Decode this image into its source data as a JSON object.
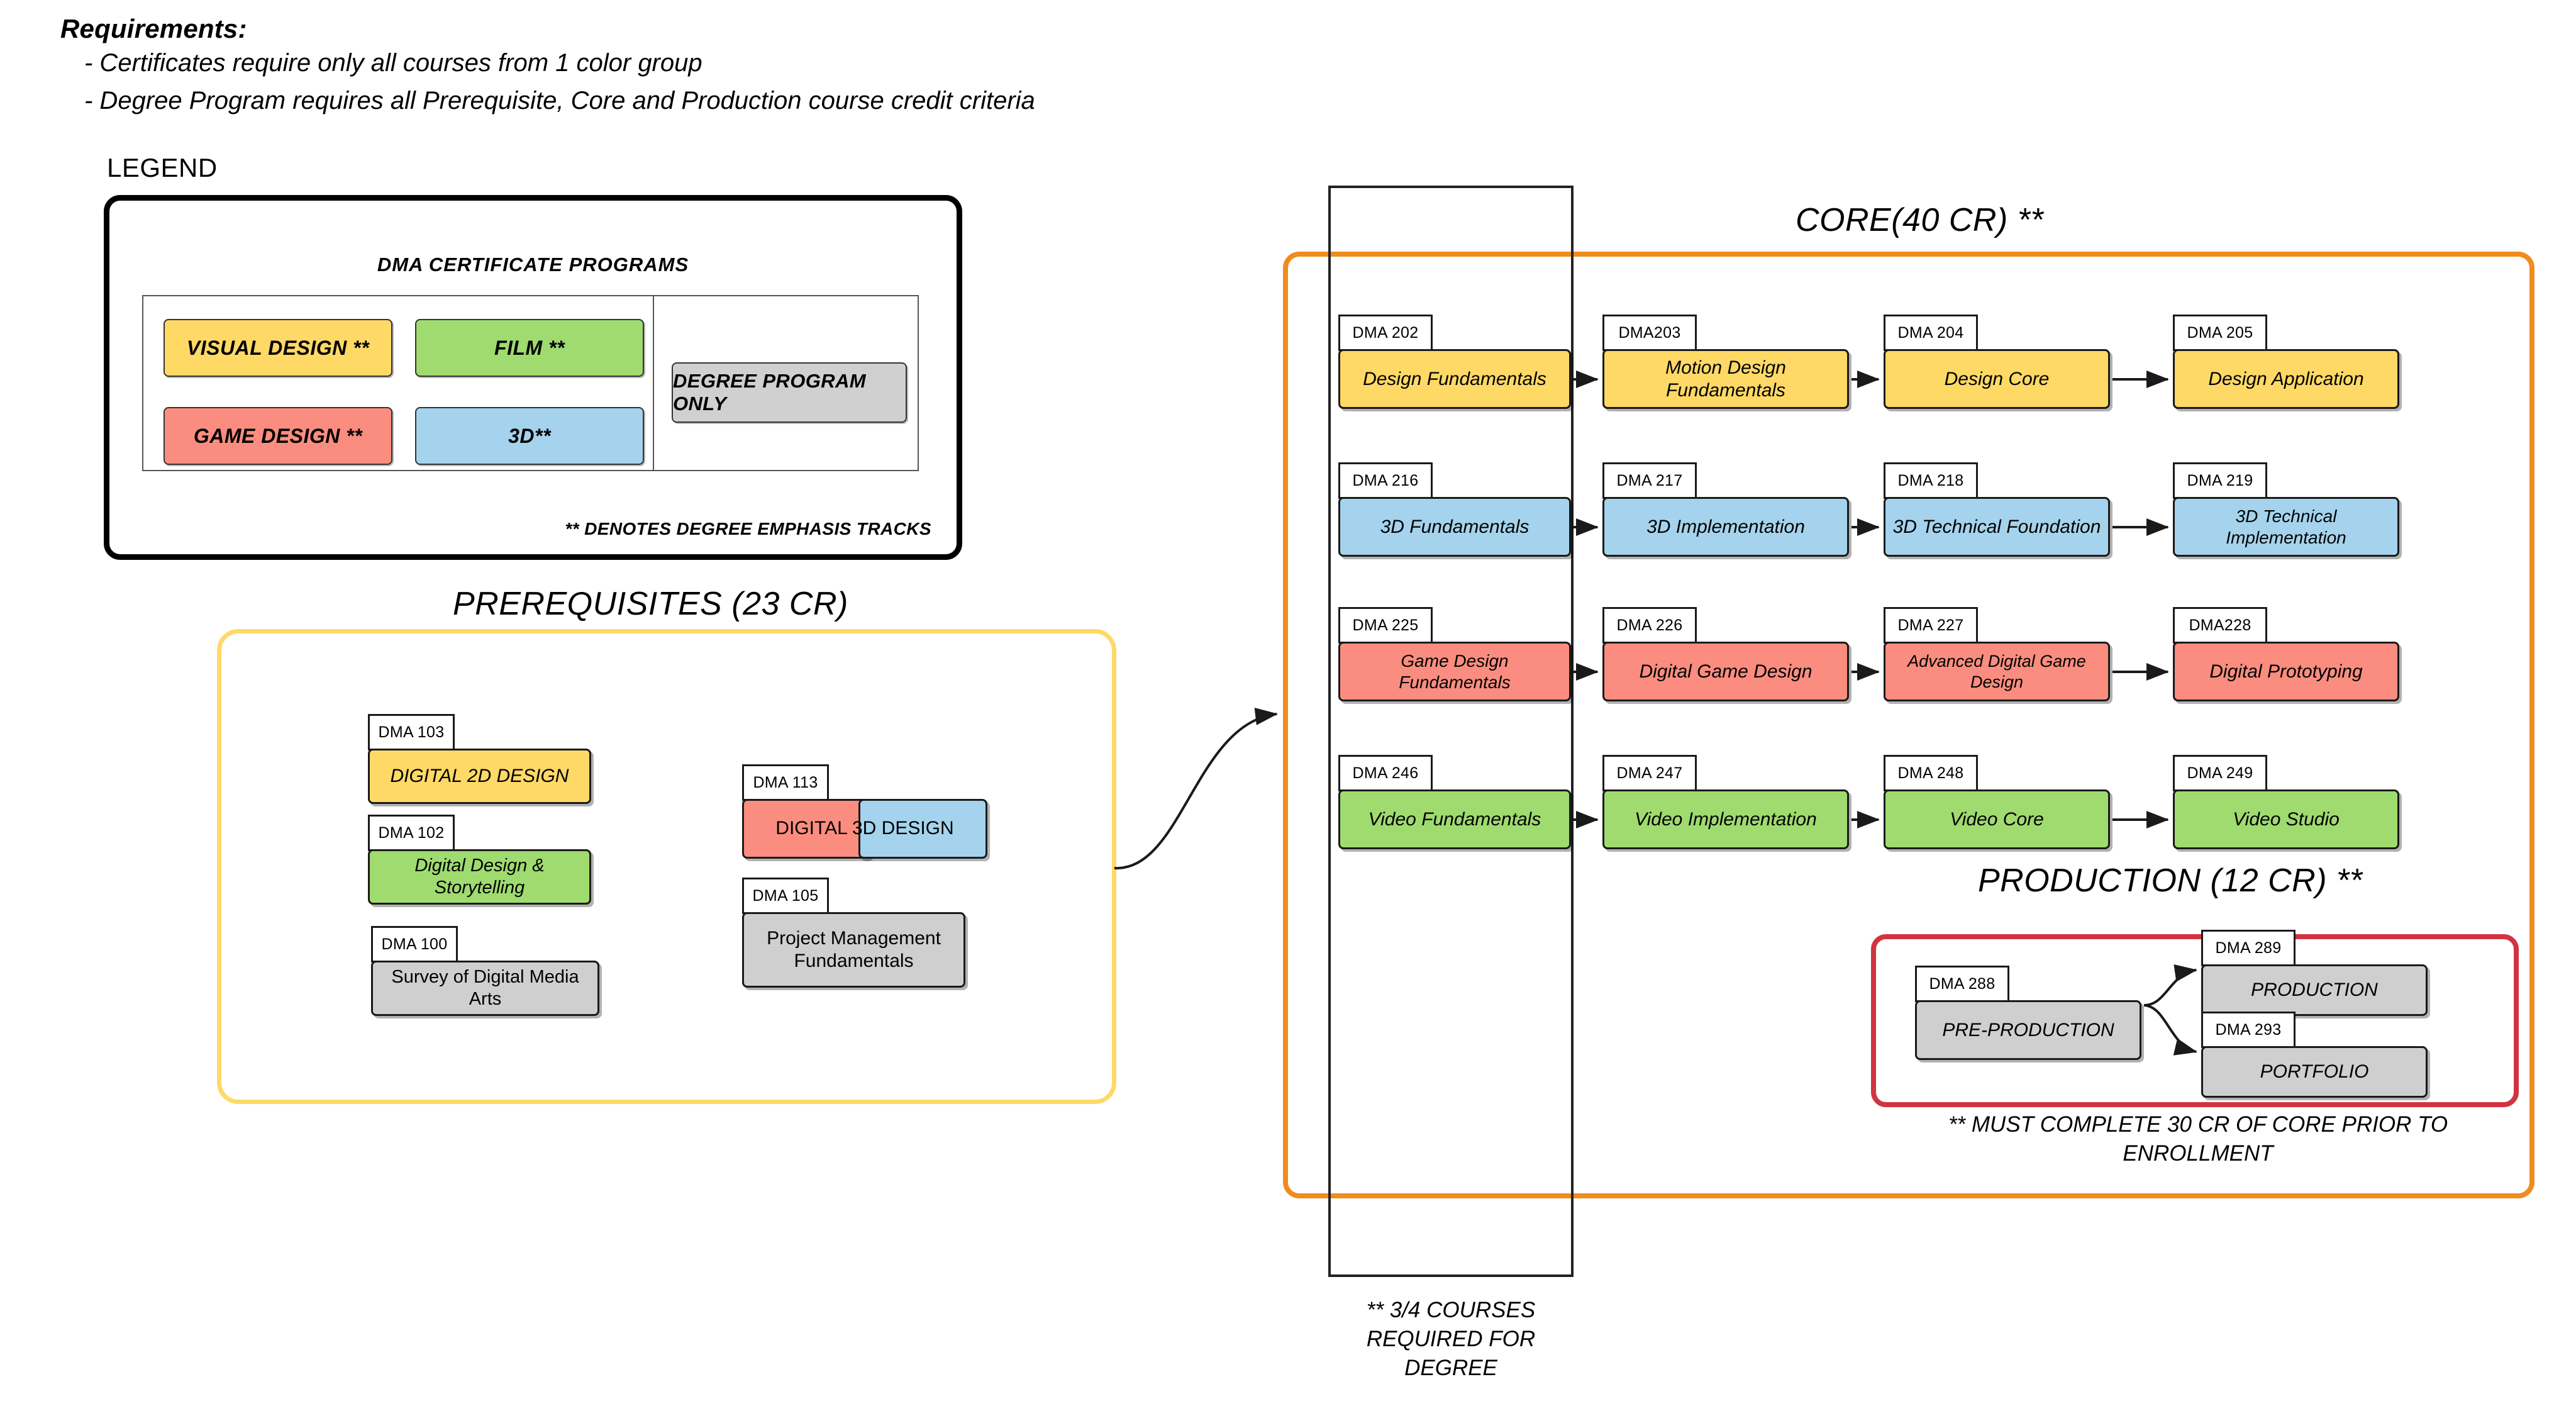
{
  "requirements": {
    "title": "Requirements:",
    "lines": [
      "- Certificates require only all courses from 1 color group",
      "- Degree Program requires all Prerequisite, Core and Production course credit criteria"
    ]
  },
  "legend": {
    "label": "LEGEND",
    "caption": "DMA CERTIFICATE PROGRAMS",
    "chips": [
      {
        "label": "VISUAL DESIGN **",
        "color": "#ffd966"
      },
      {
        "label": "FILM **",
        "color": "#9fdb6f"
      },
      {
        "label": "GAME DESIGN **",
        "color": "#fa8d7f"
      },
      {
        "label": "3D**",
        "color": "#a5d3ed"
      }
    ],
    "degree_only": "DEGREE PROGRAM ONLY",
    "footnote": "** DENOTES DEGREE EMPHASIS TRACKS"
  },
  "prerequisites": {
    "title": "PREREQUISITES (23  CR)",
    "frame_color": "#ffd966",
    "courses": [
      {
        "code": "DMA 103",
        "name": "DIGITAL 2D DESIGN",
        "color": "#ffd966",
        "italic": true
      },
      {
        "code": "DMA 102",
        "name": "Digital Design & Storytelling",
        "color": "#9fdb6f",
        "italic": true
      },
      {
        "code": "DMA 100",
        "name": "Survey of Digital Media Arts",
        "color": "#cfcfcf",
        "italic": false
      },
      {
        "code": "DMA 113",
        "name": "DIGITAL 3D DESIGN",
        "color": "#fa8d7f",
        "color_secondary": "#a5d3ed",
        "italic": false
      },
      {
        "code": "DMA 105",
        "name": "Project Management Fundamentals",
        "color": "#cfcfcf",
        "italic": false
      }
    ]
  },
  "core": {
    "title": "CORE(40 CR) **",
    "frame_color": "#f08c1e",
    "fundamentals_note": "** 3/4 COURSES REQUIRED FOR DEGREE",
    "tracks": [
      {
        "name": "Visual Design",
        "color": "#ffd966",
        "courses": [
          {
            "code": "DMA 202",
            "name": "Design Fundamentals"
          },
          {
            "code": "DMA203",
            "name": "Motion Design Fundamentals"
          },
          {
            "code": "DMA 204",
            "name": "Design Core"
          },
          {
            "code": "DMA 205",
            "name": "Design Application"
          }
        ]
      },
      {
        "name": "3D",
        "color": "#a5d3ed",
        "courses": [
          {
            "code": "DMA 216",
            "name": "3D Fundamentals"
          },
          {
            "code": "DMA 217",
            "name": "3D Implementation"
          },
          {
            "code": "DMA 218",
            "name": "3D Technical Foundation"
          },
          {
            "code": "DMA 219",
            "name": "3D Technical Implementation"
          }
        ]
      },
      {
        "name": "Game Design",
        "color": "#fa8d7f",
        "courses": [
          {
            "code": "DMA 225",
            "name": "Game Design Fundamentals"
          },
          {
            "code": "DMA 226",
            "name": "Digital Game Design"
          },
          {
            "code": "DMA 227",
            "name": "Advanced Digital Game Design"
          },
          {
            "code": "DMA228",
            "name": "Digital Prototyping"
          }
        ]
      },
      {
        "name": "Film / Video",
        "color": "#9fdb6f",
        "courses": [
          {
            "code": "DMA 246",
            "name": "Video Fundamentals"
          },
          {
            "code": "DMA 247",
            "name": "Video Implementation"
          },
          {
            "code": "DMA 248",
            "name": "Video Core"
          },
          {
            "code": "DMA 249",
            "name": "Video Studio"
          }
        ]
      }
    ]
  },
  "production": {
    "title": "PRODUCTION (12 CR) **",
    "frame_color": "#d13440",
    "note": "** MUST COMPLETE 30 CR OF CORE PRIOR TO ENROLLMENT",
    "courses": [
      {
        "code": "DMA 288",
        "name": "PRE-PRODUCTION",
        "color": "#cfcfcf"
      },
      {
        "code": "DMA 289",
        "name": "PRODUCTION",
        "color": "#cfcfcf"
      },
      {
        "code": "DMA 293",
        "name": "PORTFOLIO",
        "color": "#cfcfcf"
      }
    ]
  }
}
